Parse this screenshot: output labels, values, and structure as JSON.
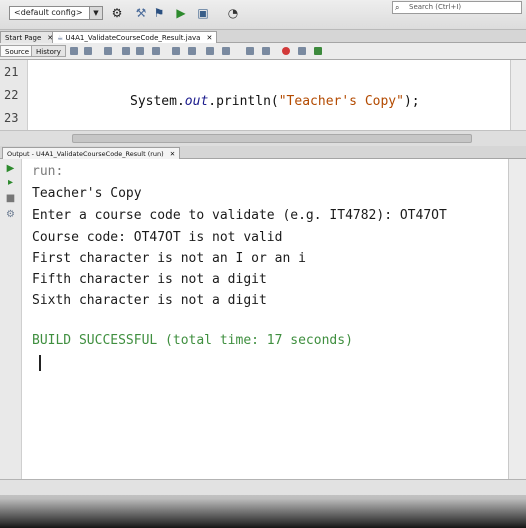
{
  "toolbar": {
    "config_value": "<default config>",
    "search_placeholder": "Search (Ctrl+I)"
  },
  "editor_tabs": [
    {
      "label": "Start Page"
    },
    {
      "label": "U4A1_ValidateCourseCode_Result.java"
    }
  ],
  "source_toolbar": {
    "source_label": "Source",
    "history_label": "History"
  },
  "editor": {
    "line_numbers": [
      "21",
      "22",
      "23"
    ],
    "code_prefix": "System.",
    "code_field": "out",
    "code_method": ".println(",
    "code_string": "\"Teacher's Copy\"",
    "code_suffix": ");"
  },
  "output": {
    "tab_label": "Output - U4A1_ValidateCourseCode_Result (run)",
    "lines": [
      "run:",
      "Teacher's Copy",
      "Enter a course code to validate (e.g. IT4782): OT47OT",
      "Course code: OT47OT is not valid",
      "First character is not an I or an i",
      "Fifth character is not a digit",
      "Sixth character is not a digit",
      "BUILD SUCCESSFUL (total time: 17 seconds)"
    ]
  },
  "colors": {
    "console_background": "#ffffff",
    "build_text": "#3f8f3f",
    "code_string": "#b34a00"
  }
}
